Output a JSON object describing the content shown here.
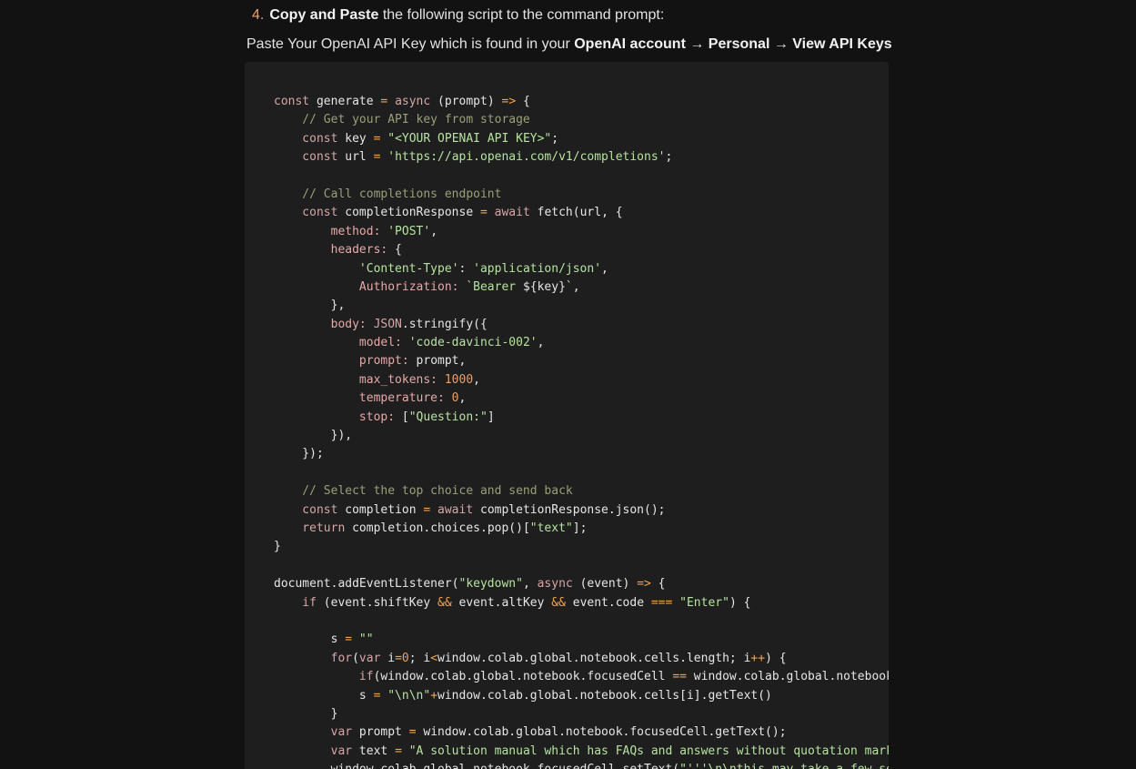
{
  "instructions": {
    "step_number": "4.",
    "step_bold": "Copy and Paste",
    "step_rest": " the following script to the command prompt:",
    "note_prefix": "Paste Your OpenAI API Key which is found in your ",
    "note_bold_1": "OpenAI account",
    "note_arrow_1": " → ",
    "note_bold_2": "Personal",
    "note_arrow_2": " → ",
    "note_bold_3": "View API Keys"
  },
  "code_lines": [
    [
      [
        "kw",
        "const"
      ],
      [
        "fn",
        " generate "
      ],
      [
        "op",
        "="
      ],
      [
        "kw",
        " async"
      ],
      [
        "fn",
        " (prompt) "
      ],
      [
        "op",
        "=>"
      ],
      [
        "fn",
        " {"
      ]
    ],
    [
      [
        "cm",
        "    // Get your API key from storage"
      ]
    ],
    [
      [
        "kw",
        "    const"
      ],
      [
        "fn",
        " key "
      ],
      [
        "op",
        "="
      ],
      [
        "str",
        " \"<YOUR OPENAI API KEY>\""
      ],
      [
        "fn",
        ";"
      ]
    ],
    [
      [
        "kw",
        "    const"
      ],
      [
        "fn",
        " url "
      ],
      [
        "op",
        "="
      ],
      [
        "str",
        " 'https://api.openai.com/v1/completions'"
      ],
      [
        "fn",
        ";"
      ]
    ],
    [
      [
        "fn",
        ""
      ]
    ],
    [
      [
        "cm",
        "    // Call completions endpoint"
      ]
    ],
    [
      [
        "kw",
        "    const"
      ],
      [
        "fn",
        " completionResponse "
      ],
      [
        "op",
        "="
      ],
      [
        "kw",
        " await"
      ],
      [
        "fn",
        " fetch(url, {"
      ]
    ],
    [
      [
        "prop",
        "        method:"
      ],
      [
        "str",
        " 'POST'"
      ],
      [
        "fn",
        ","
      ]
    ],
    [
      [
        "prop",
        "        headers:"
      ],
      [
        "fn",
        " {"
      ]
    ],
    [
      [
        "str",
        "            'Content-Type'"
      ],
      [
        "fn",
        ": "
      ],
      [
        "str",
        "'application/json'"
      ],
      [
        "fn",
        ","
      ]
    ],
    [
      [
        "prop",
        "            Authorization:"
      ],
      [
        "str",
        " `Bearer "
      ],
      [
        "fn",
        "${key}"
      ],
      [
        "str",
        "`"
      ],
      [
        "fn",
        ","
      ]
    ],
    [
      [
        "fn",
        "        },"
      ]
    ],
    [
      [
        "prop",
        "        body:"
      ],
      [
        "kw",
        " JSON"
      ],
      [
        "fn",
        ".stringify({"
      ]
    ],
    [
      [
        "prop",
        "            model:"
      ],
      [
        "str",
        " 'code-davinci-002'"
      ],
      [
        "fn",
        ","
      ]
    ],
    [
      [
        "prop",
        "            prompt:"
      ],
      [
        "fn",
        " prompt,"
      ]
    ],
    [
      [
        "prop",
        "            max_tokens:"
      ],
      [
        "num",
        " 1000"
      ],
      [
        "fn",
        ","
      ]
    ],
    [
      [
        "prop",
        "            temperature:"
      ],
      [
        "num",
        " 0"
      ],
      [
        "fn",
        ","
      ]
    ],
    [
      [
        "prop",
        "            stop:"
      ],
      [
        "fn",
        " ["
      ],
      [
        "str",
        "\"Question:\""
      ],
      [
        "fn",
        "]"
      ]
    ],
    [
      [
        "fn",
        "        }),"
      ]
    ],
    [
      [
        "fn",
        "    });"
      ]
    ],
    [
      [
        "fn",
        ""
      ]
    ],
    [
      [
        "cm",
        "    // Select the top choice and send back"
      ]
    ],
    [
      [
        "kw",
        "    const"
      ],
      [
        "fn",
        " completion "
      ],
      [
        "op",
        "="
      ],
      [
        "kw",
        " await"
      ],
      [
        "fn",
        " completionResponse.json();"
      ]
    ],
    [
      [
        "kw",
        "    return"
      ],
      [
        "fn",
        " completion.choices.pop()["
      ],
      [
        "str",
        "\"text\""
      ],
      [
        "fn",
        "];"
      ]
    ],
    [
      [
        "fn",
        "}"
      ]
    ],
    [
      [
        "fn",
        ""
      ]
    ],
    [
      [
        "fn",
        "document.addEventListener("
      ],
      [
        "str",
        "\"keydown\""
      ],
      [
        "fn",
        ", "
      ],
      [
        "kw",
        "async"
      ],
      [
        "fn",
        " (event) "
      ],
      [
        "op",
        "=>"
      ],
      [
        "fn",
        " {"
      ]
    ],
    [
      [
        "kw",
        "    if"
      ],
      [
        "fn",
        " (event.shiftKey "
      ],
      [
        "op",
        "&&"
      ],
      [
        "fn",
        " event.altKey "
      ],
      [
        "op",
        "&&"
      ],
      [
        "fn",
        " event.code "
      ],
      [
        "op",
        "==="
      ],
      [
        "str",
        " \"Enter\""
      ],
      [
        "fn",
        ") {"
      ]
    ],
    [
      [
        "fn",
        ""
      ]
    ],
    [
      [
        "fn",
        "        s "
      ],
      [
        "op",
        "="
      ],
      [
        "str",
        " \"\""
      ]
    ],
    [
      [
        "kw",
        "        for"
      ],
      [
        "fn",
        "("
      ],
      [
        "kw",
        "var"
      ],
      [
        "fn",
        " i"
      ],
      [
        "op",
        "="
      ],
      [
        "num",
        "0"
      ],
      [
        "fn",
        "; i"
      ],
      [
        "op",
        "<"
      ],
      [
        "fn",
        "window.colab.global.notebook.cells.length; i"
      ],
      [
        "op",
        "++"
      ],
      [
        "fn",
        ") {"
      ]
    ],
    [
      [
        "kw",
        "            if"
      ],
      [
        "fn",
        "(window.colab.global.notebook.focusedCell "
      ],
      [
        "op",
        "=="
      ],
      [
        "fn",
        " window.colab.global.notebook.cells[i]) break;"
      ]
    ],
    [
      [
        "fn",
        "            s "
      ],
      [
        "op",
        "="
      ],
      [
        "str",
        " \"\\n\\n\""
      ],
      [
        "op",
        "+"
      ],
      [
        "fn",
        "window.colab.global.notebook.cells[i].getText()"
      ]
    ],
    [
      [
        "fn",
        "        }"
      ]
    ],
    [
      [
        "kw",
        "        var"
      ],
      [
        "fn",
        " prompt "
      ],
      [
        "op",
        "="
      ],
      [
        "fn",
        " window.colab.global.notebook.focusedCell.getText();"
      ]
    ],
    [
      [
        "kw",
        "        var"
      ],
      [
        "fn",
        " text "
      ],
      [
        "op",
        "="
      ],
      [
        "str",
        " \"A solution manual which has FAQs and answers without quotation marks in code blocks:\""
      ]
    ],
    [
      [
        "fn",
        "        window.colab.global.notebook.focusedCell.setText("
      ],
      [
        "str",
        "\"'''\\n\\nthis may take a few seconds\""
      ],
      [
        "fn",
        ");"
      ]
    ]
  ]
}
